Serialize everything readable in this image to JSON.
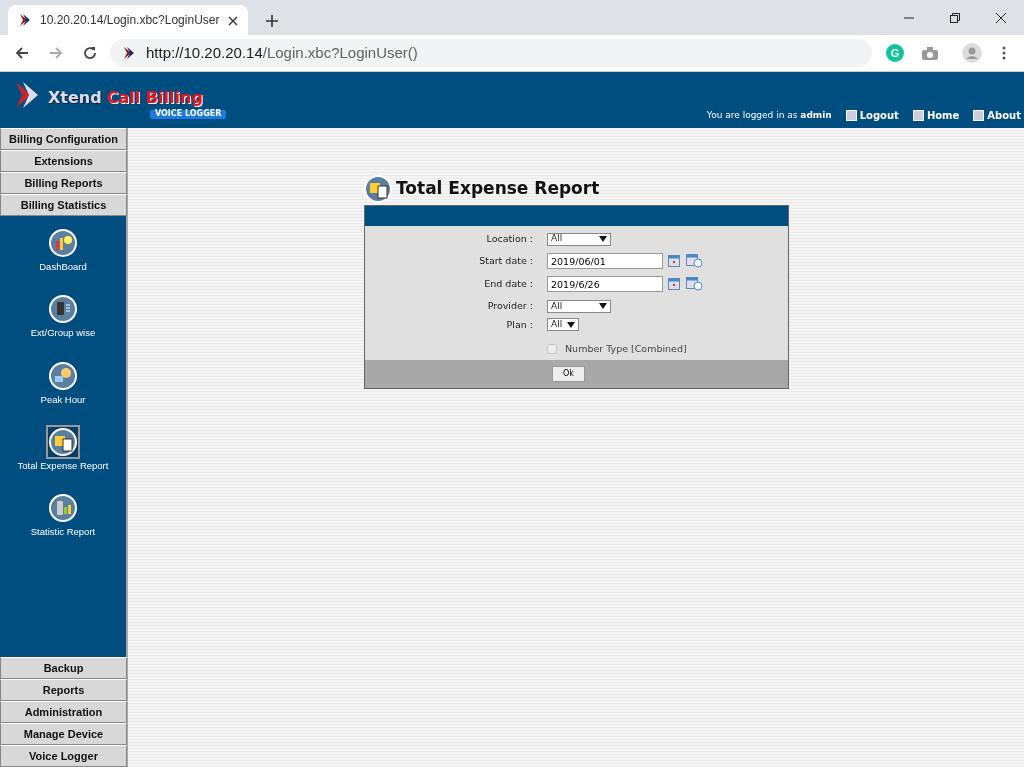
{
  "browser": {
    "tab_title": "10.20.20.14/Login.xbc?LoginUser",
    "url_host": "http://10.20.20.14",
    "url_path": "/Login.xbc?LoginUser()",
    "extension_letter": "G"
  },
  "header": {
    "logo_word": "Xtend",
    "logo_brand": "Call Billing",
    "logo_sub": "VOICE LOGGER",
    "login_prefix": "You are logged in as",
    "user": "admin",
    "links": [
      "Logout",
      "Home",
      "About"
    ]
  },
  "sidebar": {
    "top_menu": [
      {
        "label": "Billing Configuration"
      },
      {
        "label": "Extensions"
      },
      {
        "label": "Billing Reports"
      },
      {
        "label": "Billing Statistics"
      }
    ],
    "items": [
      {
        "label": "DashBoard",
        "kind": "dashboard",
        "selected": false
      },
      {
        "label": "Ext/Group wise",
        "kind": "phone",
        "selected": false
      },
      {
        "label": "Peak Hour",
        "kind": "clock",
        "selected": false
      },
      {
        "label": "Total Expense Report",
        "kind": "expense",
        "selected": true
      },
      {
        "label": "Statistic Report",
        "kind": "stats",
        "selected": false
      }
    ],
    "bottom_menu": [
      {
        "label": "Backup"
      },
      {
        "label": "Reports"
      },
      {
        "label": "Administration"
      },
      {
        "label": "Manage Device"
      },
      {
        "label": "Voice Logger"
      }
    ]
  },
  "report": {
    "title": "Total Expense Report",
    "fields": [
      {
        "label": "Location :",
        "kind": "select",
        "value": "All"
      },
      {
        "label": "Start date :",
        "kind": "date",
        "value": "2019/06/01"
      },
      {
        "label": "End date :",
        "kind": "date",
        "value": "2019/6/26"
      },
      {
        "label": "Provider :",
        "kind": "select",
        "value": "All"
      },
      {
        "label": "Plan :",
        "kind": "small_select",
        "value": "All"
      }
    ],
    "checkbox": {
      "label": "Number Type [Combined]",
      "checked": false,
      "disabled": true
    },
    "ok_button": "Ok"
  }
}
